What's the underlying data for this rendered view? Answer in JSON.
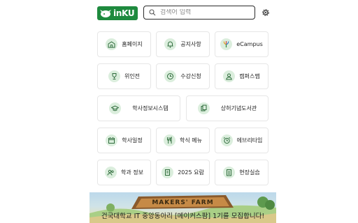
{
  "header": {
    "logo_text": "inKU",
    "search_placeholder": "검색어 입력"
  },
  "menu": {
    "homepage": "홈페이지",
    "notice": "공지사항",
    "ecampus": "eCampus",
    "committee": "위인전",
    "course_registration": "수강신청",
    "campus_map": "캠퍼스맵",
    "academic_info": "학사정보시스템",
    "library": "상허기념도서관",
    "academic_calendar": "학사일정",
    "cafeteria_menu": "학식 메뉴",
    "every_time": "에브리타임",
    "dept_info": "학과 정보",
    "handbook": "2025 요람",
    "field_practice": "현장실습"
  },
  "banner": {
    "title": "MAKERS' FARM",
    "text": "건국대학교 IT 중앙동아리 [메이커스팜] 1기를 모집합니다!"
  },
  "colors": {
    "brand_green": "#1e8a3e",
    "icon_bg": "#dbeedd",
    "tile_border": "#e6e6e6"
  }
}
